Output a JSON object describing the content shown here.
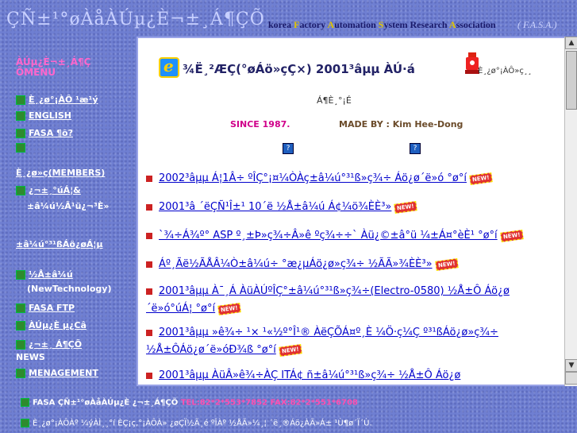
{
  "header": {
    "logo_garbled": "ÇÑ±¹°øÀåÀÚµ¿È¬±¸Á¶ÇÕ",
    "org_name_parts": [
      {
        "cap": "",
        "rest": "korea "
      },
      {
        "cap": "F",
        "rest": "actory "
      },
      {
        "cap": "A",
        "rest": "utomation "
      },
      {
        "cap": "S",
        "rest": "ystem Research "
      },
      {
        "cap": "A",
        "rest": "ssociation"
      }
    ],
    "abbr": "( F.A.S.A.)"
  },
  "sidebar": {
    "title": "ÀÚµ¿È¬±¸Á¶Ç ÕMENU",
    "items": [
      {
        "label": "È¸¿ø°¡ÀÔ ¹æ¹ý"
      },
      {
        "label": "ENGLISH"
      },
      {
        "label": "FASA ¶õ?"
      },
      {
        "label": "È¸¿ø»ç(MEMBERS)"
      },
      {
        "label": "¿¬±¸°úÁ¦&",
        "sub": "±â¼ú½Ã¹ü¿¬³È»"
      },
      {
        "label": "±â¼ú°³¹ßÁö¿øÁ¦µ"
      },
      {
        "label": "½Å±â¼ú",
        "sub": "(NewTechnology)"
      },
      {
        "label": "FASA FTP"
      },
      {
        "label": "ÀÚµ¿È µ¿Câ"
      },
      {
        "label": "¿¬±¸ Á¶ÇÕ",
        "sub": "NEWS"
      },
      {
        "label": "MENAGEMENT"
      }
    ]
  },
  "main": {
    "title": "¾Ë¸²ÆÇ(°øÁö»çÇ×) 2001³âµµ ÀÚ·á",
    "hydrant_label": "È¸¿ø°¡ÀÔ»ç¸¸",
    "hydrant2_label": "Á¶È¸°¡É",
    "since": "SINCE 1987.",
    "made_by": "MADE BY : Kim Hee-Dong",
    "help_icons": [
      "?",
      "?"
    ],
    "news": [
      {
        "text": "2002³âµµ Á¦1Â÷ ºÎÇ°¡¤¼ÒÀç±â¼ú°³¹ß»ç¾÷ Áö¿ø´ë»ó °ø°í",
        "new": "NEW!"
      },
      {
        "text": "2001³â ´ëÇÑ¹Î±¹ 10´ë ½Å±â¼ú Á¢¼ö¾ÈÈ³»",
        "new": "NEW!"
      },
      {
        "text": "`¾÷Á¾º° ASP º¸±Þ»ç¾÷Â»ê ºç¾÷÷` Àü¿©±â°ü ¼±Á¤°èÈ¹ °ø°í",
        "new": "NEW!"
      },
      {
        "text": "Áº¸Ãë½ÃÅÂ¼Ò±â¼ú÷ °æ¿µÁö¿ø»ç¾÷ ½ÃÃ»¾ÈÈ³»",
        "new": "NEW!"
      },
      {
        "text": "2001³âµµ À¯¸Á ÀüÀÚºÎÇ°±â¼ú°³¹ß»ç¾÷(Electro-0580) ½Å±Ô Áö¿ø´ë»ó°úÁ¦ °ø°í",
        "new": "NEW!"
      },
      {
        "text": "2001³âµµ »ê¾÷ ¹× ¹«½º°Î¹® ÀëÇÕÁ¤º¸È ¼Ö·ç¼Ç º³¹ßÁö¿ø»ç¾÷ ½Å±ÔÁö¿ø´ë»óÐ¾ß °ø°í",
        "new": "NEW!"
      },
      {
        "text": "2001³âµµ ÀüÂ»ê¾÷ÀÇ ITÁ¢ ñ±â¼ú°³¹ß»ç¾÷ ½Å±Ô Áö¿ø",
        "new": ""
      }
    ]
  },
  "footer": {
    "line1_label": "FASA ÇÑ±¹°øÀåÀÚµ¿È ¿¬±¸Á¶ÇÕ",
    "line1_contact": "TEL:82*2*553*7852  FAX:82*2*551*6708",
    "line2_label": "È¸¿ø°¡ÀÔÀº ¼ýÀÌ¸¸°í ÈÇ¡ç,°¡ÀÔÀ» ¿øÇÏ½Ã¸é ºÎÀº ½ÅÃ»¼­¸¦ ´ë¸®Áö¿ÀÃ»Á± ¹Ù¶ø´Ï´Ù."
  },
  "colors": {
    "background": "#6f7fd2",
    "menu_title": "#ff66cc",
    "link": "#0000cc",
    "since": "#d0008a",
    "footer_contact": "#ff4fb0"
  }
}
